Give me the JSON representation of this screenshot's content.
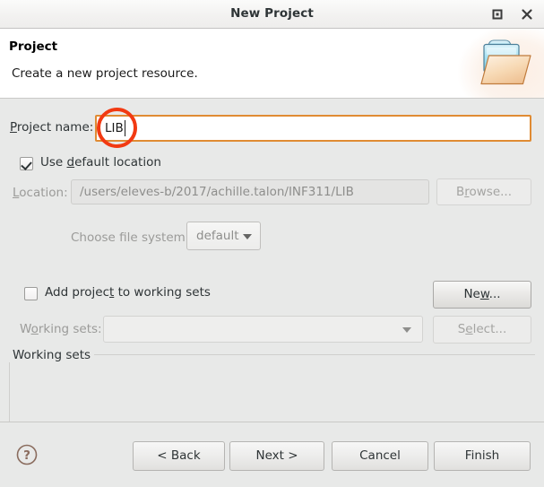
{
  "window": {
    "title": "New Project",
    "maximize_icon": "maximize-icon",
    "close_icon": "close-icon"
  },
  "header": {
    "title": "Project",
    "subtitle": "Create a new project resource.",
    "icon": "open-folder-icon"
  },
  "form": {
    "project_name_label": "Project name:",
    "project_name_value": "LIB",
    "use_default_location_label_pre": "Use ",
    "use_default_location_label_accel": "d",
    "use_default_location_label_post": "efault location",
    "use_default_location_checked": true,
    "location_label": "Location:",
    "location_value": "/users/eleves-b/2017/achille.talon/INF311/LIB",
    "browse_label_pre": "B",
    "browse_label_accel": "r",
    "browse_label_post": "owse...",
    "file_system_label": "Choose file system:",
    "file_system_value": "default"
  },
  "working_sets": {
    "group_label": "Working sets",
    "add_checkbox_label_pre": "Add projec",
    "add_checkbox_label_accel": "t",
    "add_checkbox_label_post": " to working sets",
    "add_checkbox_checked": false,
    "new_label_pre": "Ne",
    "new_label_accel": "w",
    "new_label_post": "...",
    "sets_label_pre": "W",
    "sets_label_accel": "o",
    "sets_label_post": "rking sets:",
    "sets_value": "",
    "select_label_pre": "S",
    "select_label_accel": "e",
    "select_label_post": "lect..."
  },
  "footer": {
    "help_icon": "help-circle-icon",
    "back_label": "< Back",
    "next_label": "Next >",
    "cancel_label": "Cancel",
    "finish_label": "Finish"
  },
  "annotation": {
    "shape": "circle-highlight",
    "color": "#f23a12"
  },
  "colors": {
    "focus_border": "#e08b33",
    "dialog_bg": "#e8e9e8",
    "header_bg": "#ffffff",
    "annotation": "#f23a12"
  }
}
